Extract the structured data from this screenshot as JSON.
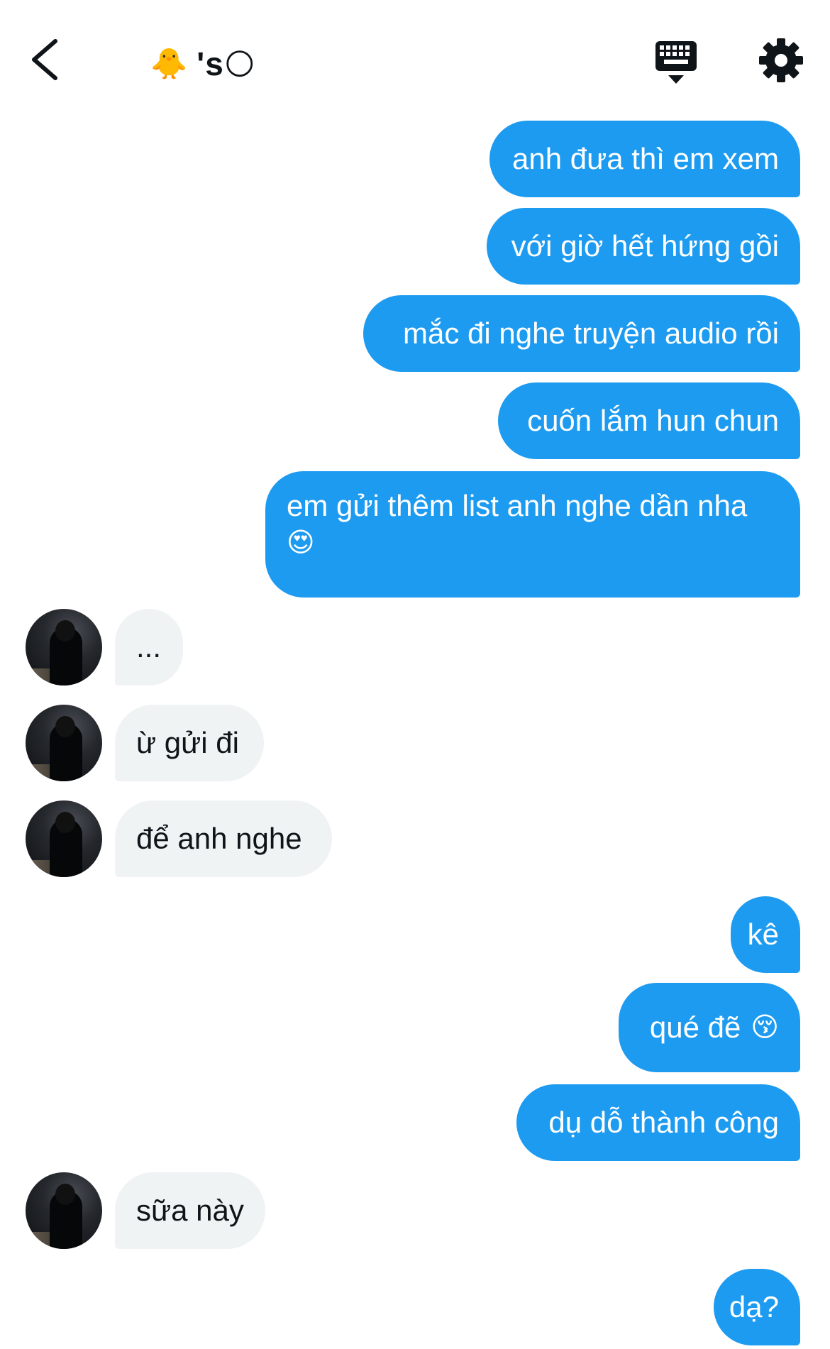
{
  "header": {
    "title_emoji_left": "🐥",
    "title_text": "'s",
    "title_emoji_right": "🌕",
    "icons": {
      "back": "back-arrow-icon",
      "keyboard": "keyboard-icon",
      "settings": "gear-icon"
    }
  },
  "messages": [
    {
      "side": "sent",
      "text": "anh đưa thì em xem"
    },
    {
      "side": "sent",
      "text": "với giờ hết hứng gồi"
    },
    {
      "side": "sent",
      "text": "mắc đi nghe truyện audio rồi"
    },
    {
      "side": "sent",
      "text": "cuốn lắm hun chun"
    },
    {
      "side": "sent",
      "text": "em gửi thêm list anh nghe dần nha",
      "emoji": "😍"
    },
    {
      "side": "received",
      "text": "..."
    },
    {
      "side": "received",
      "text": "ừ gửi đi"
    },
    {
      "side": "received",
      "text": "để anh nghe"
    },
    {
      "side": "sent",
      "text": "kê"
    },
    {
      "side": "sent",
      "text": "qué đẽ",
      "emoji": "😚"
    },
    {
      "side": "sent",
      "text": "dụ dỗ thành công"
    },
    {
      "side": "received",
      "text": "sữa này"
    },
    {
      "side": "sent",
      "text": "dạ?"
    }
  ],
  "colors": {
    "sent_bubble": "#1d9bf0",
    "received_bubble": "#eff3f4",
    "text_dark": "#0f1419"
  }
}
